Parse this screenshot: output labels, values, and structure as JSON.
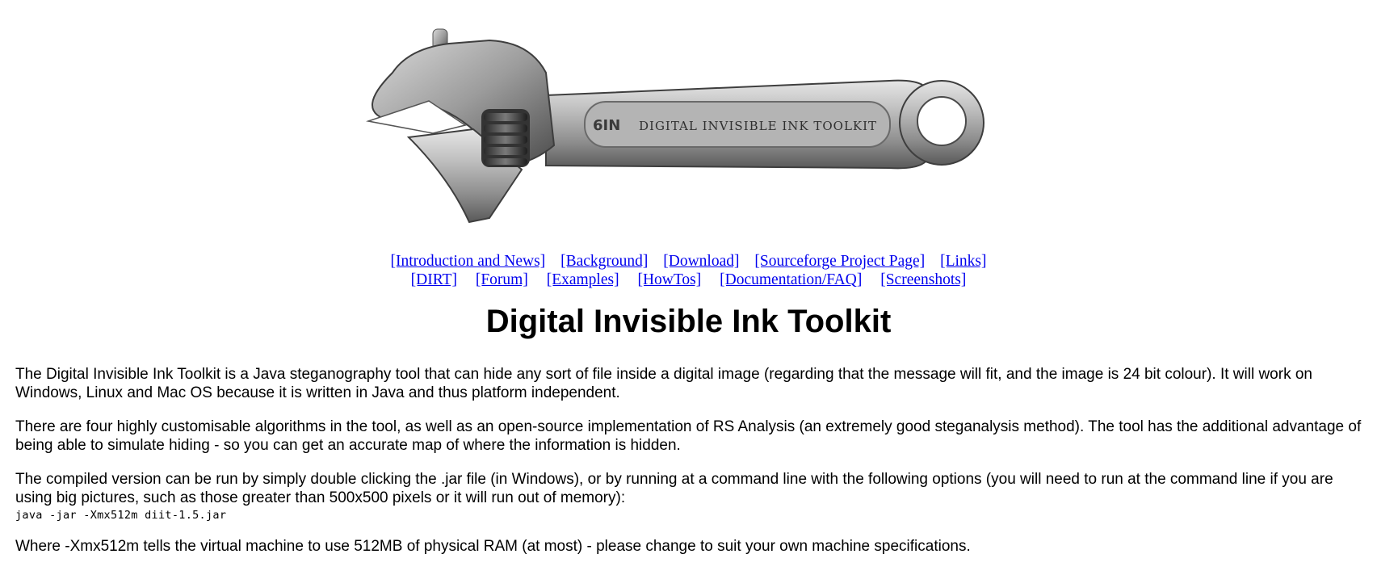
{
  "banner": {
    "engraving_size": "6IN",
    "engraving_text": "DIGITAL INVISIBLE INK TOOLKIT"
  },
  "nav": {
    "row1": [
      {
        "label": "[Introduction and News]"
      },
      {
        "label": "[Background]"
      },
      {
        "label": "[Download]"
      },
      {
        "label": "[Sourceforge Project Page]"
      },
      {
        "label": "[Links]"
      }
    ],
    "row2": [
      {
        "label": "[DIRT]"
      },
      {
        "label": "[Forum]"
      },
      {
        "label": "[Examples]"
      },
      {
        "label": "[HowTos]"
      },
      {
        "label": "[Documentation/FAQ]"
      },
      {
        "label": "[Screenshots]"
      }
    ],
    "link_color": "#0000ee"
  },
  "page_title": "Digital Invisible Ink Toolkit",
  "content": {
    "p1": "The Digital Invisible Ink Toolkit is a Java steganography tool that can hide any sort of file inside a digital image (regarding that the message will fit, and the image is 24 bit colour). It will work on Windows, Linux and Mac OS because it is written in Java and thus platform independent.",
    "p2": "There are four highly customisable algorithms in the tool, as well as an open-source implementation of RS Analysis (an extremely good steganalysis method). The tool has the additional advantage of being able to simulate hiding - so you can get an accurate map of where the information is hidden.",
    "p3": "The compiled version can be run by simply double clicking the .jar file (in Windows), or by running at a command line with the following options (you will need to run at the command line if you are using big pictures, such as those greater than 500x500 pixels or it will run out of memory):",
    "command": "java -jar -Xmx512m diit-1.5.jar",
    "p4": "Where -Xmx512m tells the virtual machine to use 512MB of physical RAM (at most) - please change to suit your own machine specifications."
  }
}
